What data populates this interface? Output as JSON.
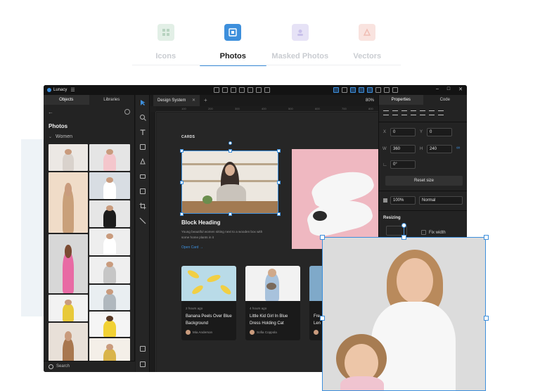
{
  "top_tabs": [
    {
      "label": "Icons",
      "color": "#cfe3d6"
    },
    {
      "label": "Photos",
      "color": "#3d8fdc"
    },
    {
      "label": "Masked Photos",
      "color": "#dcd6f2"
    },
    {
      "label": "Vectors",
      "color": "#f6d7d2"
    }
  ],
  "active_tab": "Photos",
  "app": {
    "name": "Lunacy",
    "left_tabs": [
      "Objects",
      "Libraries"
    ],
    "section_title": "Photos",
    "category": "Women",
    "search_placeholder": "Search",
    "document_tab": "Design System",
    "zoom": "80%",
    "ruler_marks": [
      "100",
      "200",
      "300",
      "400",
      "500",
      "600",
      "700",
      "800"
    ]
  },
  "artboard": {
    "section_label": "CARDS",
    "hero": {
      "heading": "Block Heading",
      "description": "Young beautiful women sitting next to a wooden box with some home plants in it",
      "link": "Open Card →"
    },
    "cards": [
      {
        "ago": "2 hours ago",
        "title": "Banana Peels Over Blue Background",
        "author": "Mia Anderson",
        "image_color": "#b9dbe8"
      },
      {
        "ago": "4 hours ago",
        "title": "Little Kid Girl In Blue Dress Holding Cat",
        "author": "Sofia Coppola",
        "image_color": "#f2f2f2"
      },
      {
        "ago": "",
        "title": "Fre Len",
        "author": "",
        "image_color": "#7fa9c9"
      }
    ]
  },
  "properties": {
    "tabs": [
      "Properties",
      "Code"
    ],
    "x_label": "X",
    "x": "0",
    "y_label": "Y",
    "y": "0",
    "w_label": "W",
    "w": "360",
    "h_label": "H",
    "h": "240",
    "rotation": "0°",
    "reset_label": "Reset size",
    "opacity": "100%",
    "blend": "Normal",
    "resizing_label": "Resizing",
    "fix_width_label": "Fix width"
  },
  "colors": {
    "accent": "#3d8fdc",
    "app_bg": "#1e1e1e",
    "panel_bg": "#232323"
  }
}
